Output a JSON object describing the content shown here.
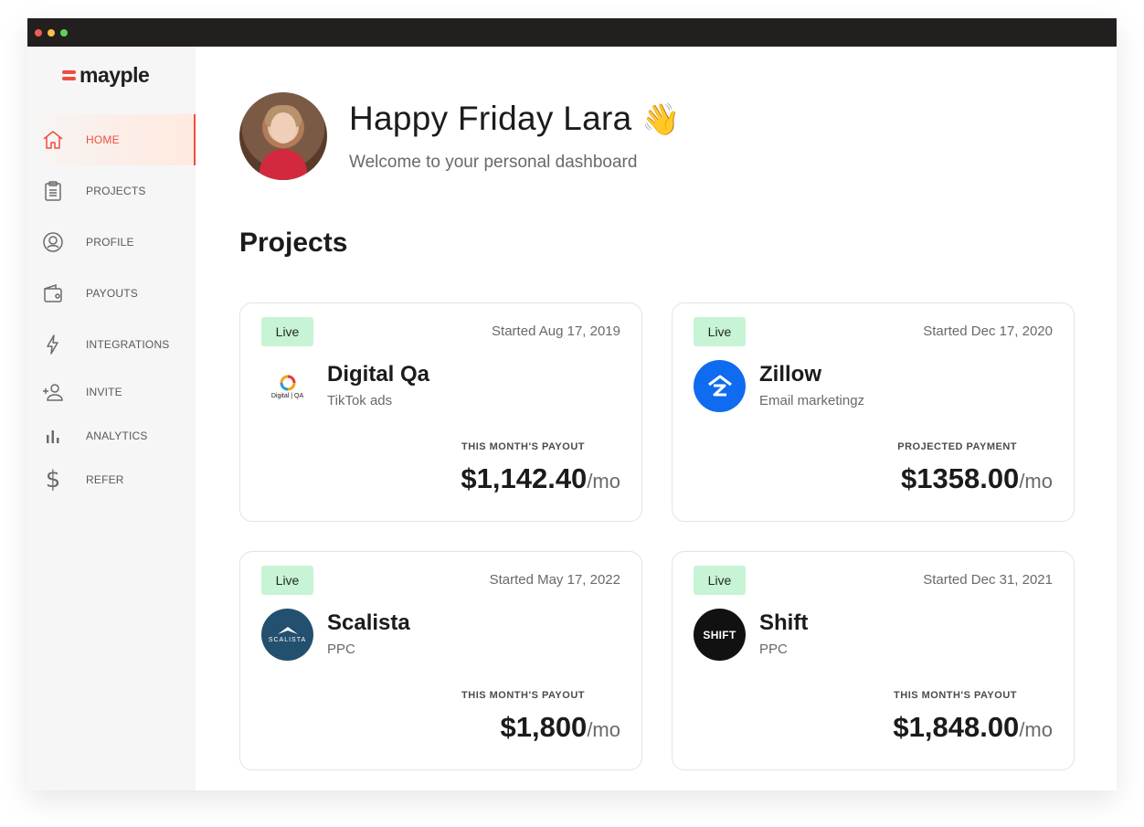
{
  "app": {
    "logo_text": "mayple",
    "brand_color": "#ef4d3f",
    "window_dots": [
      "#ef5d55",
      "#f7c146",
      "#5ed157"
    ]
  },
  "sidebar": {
    "items": [
      {
        "label": "HOME",
        "icon": "home-icon",
        "active": true
      },
      {
        "label": "PROJECTS",
        "icon": "clipboard-icon",
        "active": false
      },
      {
        "label": "PROFILE",
        "icon": "user-circle-icon",
        "active": false
      },
      {
        "label": "PAYOUTS",
        "icon": "wallet-icon",
        "active": false
      },
      {
        "label": "INTEGRATIONS",
        "icon": "lightning-icon",
        "active": false
      },
      {
        "label": "INVITE",
        "icon": "add-person-icon",
        "active": false
      },
      {
        "label": "ANALYTICS",
        "icon": "bar-chart-icon",
        "active": false
      },
      {
        "label": "REFER",
        "icon": "dollar-icon",
        "active": false
      }
    ]
  },
  "header": {
    "greeting": "Happy Friday Lara",
    "emoji": "👋",
    "subtitle": "Welcome to your personal dashboard"
  },
  "projects": {
    "title": "Projects",
    "cards": [
      {
        "status": "Live",
        "started": "Started Aug 17, 2019",
        "name": "Digital Qa",
        "type": "TikTok ads",
        "payout_label": "THIS MONTH'S PAYOUT",
        "amount": "$1,142.40",
        "per": "/mo",
        "logo_text": "Digital | QA"
      },
      {
        "status": "Live",
        "started": "Started Dec 17, 2020",
        "name": "Zillow",
        "type": "Email marketingz",
        "payout_label": "PROJECTED PAYMENT",
        "amount": "$1358.00",
        "per": "/mo",
        "logo_text": ""
      },
      {
        "status": "Live",
        "started": "Started May 17, 2022",
        "name": "Scalista",
        "type": "PPC",
        "payout_label": "THIS MONTH'S PAYOUT",
        "amount": "$1,800",
        "per": "/mo",
        "logo_text": "SCALISTA"
      },
      {
        "status": "Live",
        "started": "Started Dec 31, 2021",
        "name": "Shift",
        "type": "PPC",
        "payout_label": "THIS MONTH'S PAYOUT",
        "amount": "$1,848.00",
        "per": "/mo",
        "logo_text": "SHIFT"
      }
    ]
  }
}
